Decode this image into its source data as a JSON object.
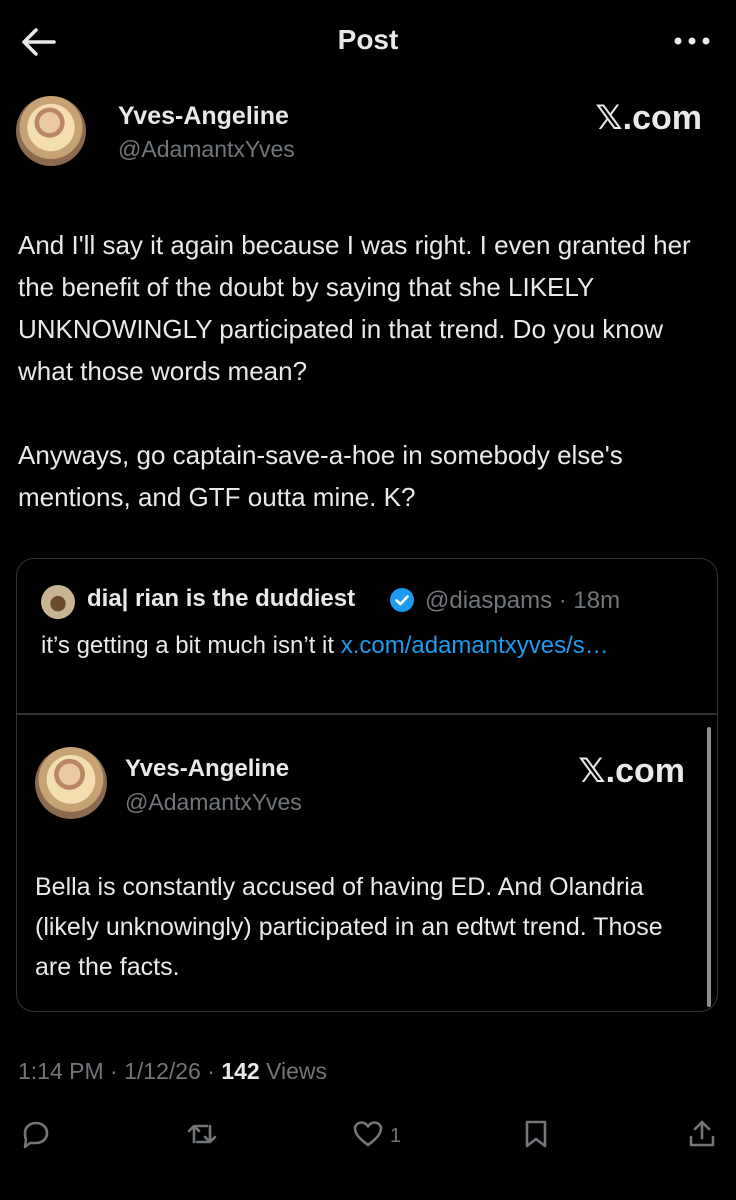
{
  "header": {
    "title": "Post"
  },
  "post": {
    "display_name": "Yves-Angeline",
    "handle": "@AdamantxYves",
    "brand": "𝕏.com",
    "text": "And I'll say it again because I was right. I even granted her the benefit of the doubt by saying that she LIKELY UNKNOWINGLY participated in that trend. Do you know what those words mean?\n\nAnyways, go captain-save-a-hoe in somebody else's mentions, and GTF outta mine. K?",
    "time": "1:14 PM",
    "separator": "·",
    "date": "1/12/26",
    "views_count": "142",
    "views_label": "Views",
    "like_count": "1"
  },
  "quote": {
    "display_name": "dia| rian is the duddiest",
    "handle_time": "@diaspams · 18m",
    "text": "it’s getting a bit much isn’t it ",
    "link": "x.com/adamantxyves/s…",
    "inner": {
      "display_name": "Yves-Angeline",
      "handle": "@AdamantxYves",
      "brand": "𝕏.com",
      "text": "Bella is constantly accused of having ED. And Olandria (likely unknowingly) participated in an edtwt trend. Those are the facts."
    }
  },
  "colors": {
    "background": "#000000",
    "text": "#e7e9ea",
    "muted": "#71767b",
    "accent": "#1d9bf0",
    "border": "#2f3336"
  },
  "icons": [
    "back-arrow-icon",
    "more-icon",
    "verified-icon",
    "reply-icon",
    "repost-icon",
    "like-icon",
    "bookmark-icon",
    "share-icon"
  ]
}
